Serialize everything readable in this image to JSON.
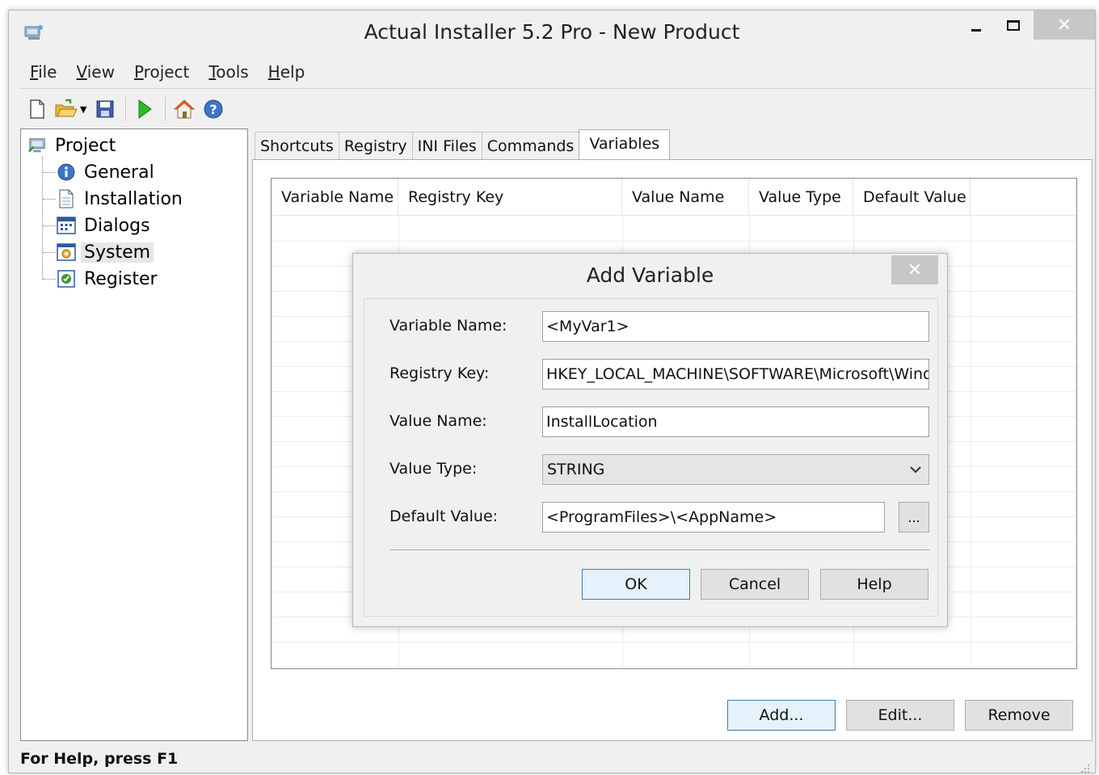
{
  "window": {
    "title": "Actual Installer 5.2 Pro - New Product",
    "close_glyph": "✕"
  },
  "menu": [
    {
      "first": "F",
      "rest": "ile"
    },
    {
      "first": "V",
      "rest": "iew"
    },
    {
      "first": "P",
      "rest": "roject"
    },
    {
      "first": "T",
      "rest": "ools"
    },
    {
      "first": "H",
      "rest": "elp"
    }
  ],
  "toolbar": {
    "icons": [
      "new-file-icon",
      "open-folder-icon",
      "save-icon",
      "run-icon",
      "home-icon",
      "help-icon"
    ]
  },
  "tree": {
    "root": "Project",
    "items": [
      {
        "label": "General",
        "icon": "info-icon"
      },
      {
        "label": "Installation",
        "icon": "document-icon"
      },
      {
        "label": "Dialogs",
        "icon": "dialog-icon"
      },
      {
        "label": "System",
        "icon": "system-icon",
        "selected": true
      },
      {
        "label": "Register",
        "icon": "register-icon"
      }
    ]
  },
  "tabs": [
    "Shortcuts",
    "Registry",
    "INI Files",
    "Commands",
    "Variables"
  ],
  "active_tab": "Variables",
  "grid": {
    "columns": [
      "Variable Name",
      "Registry Key",
      "Value Name",
      "Value Type",
      "Default Value"
    ]
  },
  "buttons": {
    "add": "Add...",
    "edit": "Edit...",
    "remove": "Remove"
  },
  "status": "For Help, press F1",
  "dialog": {
    "title": "Add Variable",
    "close_glyph": "✕",
    "fields": {
      "variable_name": {
        "label": "Variable Name:",
        "value": "<MyVar1>"
      },
      "registry_key": {
        "label": "Registry Key:",
        "value": "HKEY_LOCAL_MACHINE\\SOFTWARE\\Microsoft\\Windc"
      },
      "value_name": {
        "label": "Value Name:",
        "value": "InstallLocation"
      },
      "value_type": {
        "label": "Value Type:",
        "value": "STRING"
      },
      "default_value": {
        "label": "Default Value:",
        "value": "<ProgramFiles>\\<AppName>"
      }
    },
    "browse_label": "...",
    "ok": "OK",
    "cancel": "Cancel",
    "help": "Help"
  },
  "colors": {
    "accent_border": "#3c7fb1",
    "window_bg": "#f0f0f0"
  }
}
